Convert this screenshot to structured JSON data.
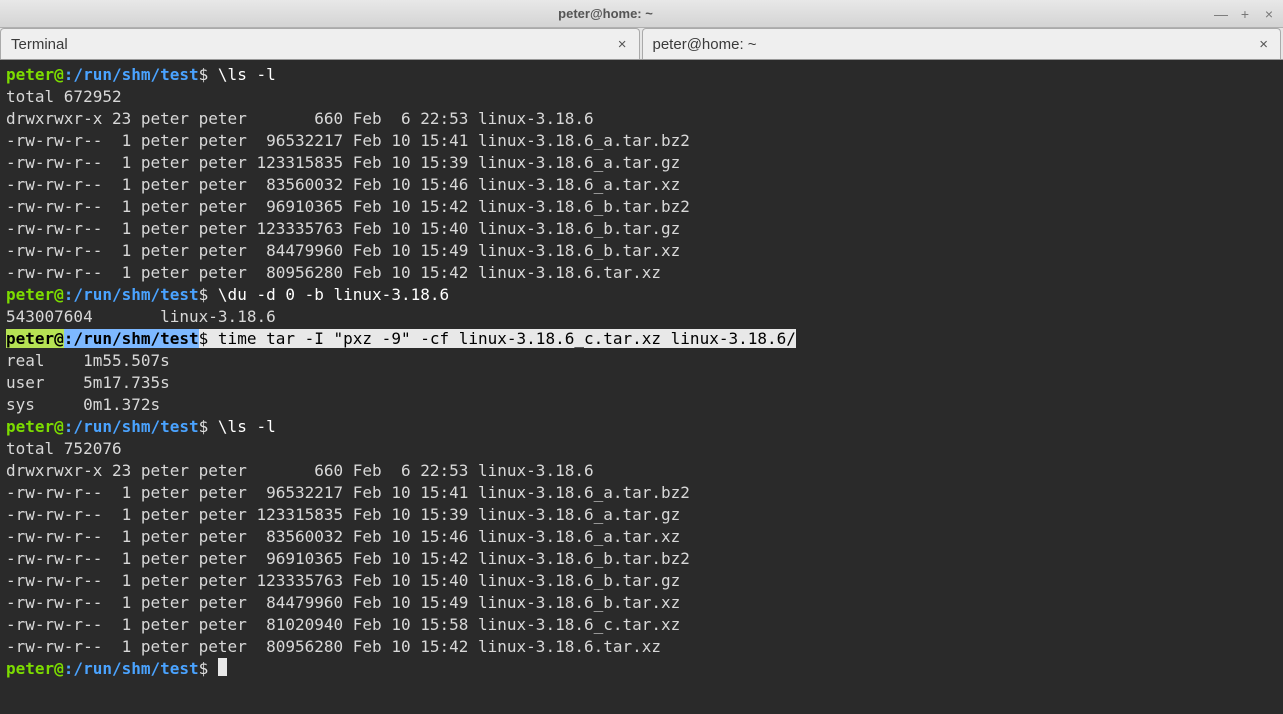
{
  "window": {
    "title": "peter@home: ~"
  },
  "tabs": [
    {
      "label": "Terminal"
    },
    {
      "label": "peter@home: ~"
    }
  ],
  "prompt": {
    "user": "peter@",
    "path": ":/run/shm/test",
    "dollar": "$ "
  },
  "cmd1": "\\ls -l",
  "total1": "total 672952",
  "ls1": [
    "drwxrwxr-x 23 peter peter       660 Feb  6 22:53 linux-3.18.6",
    "-rw-rw-r--  1 peter peter  96532217 Feb 10 15:41 linux-3.18.6_a.tar.bz2",
    "-rw-rw-r--  1 peter peter 123315835 Feb 10 15:39 linux-3.18.6_a.tar.gz",
    "-rw-rw-r--  1 peter peter  83560032 Feb 10 15:46 linux-3.18.6_a.tar.xz",
    "-rw-rw-r--  1 peter peter  96910365 Feb 10 15:42 linux-3.18.6_b.tar.bz2",
    "-rw-rw-r--  1 peter peter 123335763 Feb 10 15:40 linux-3.18.6_b.tar.gz",
    "-rw-rw-r--  1 peter peter  84479960 Feb 10 15:49 linux-3.18.6_b.tar.xz",
    "-rw-rw-r--  1 peter peter  80956280 Feb 10 15:42 linux-3.18.6.tar.xz"
  ],
  "cmd2": "\\du -d 0 -b linux-3.18.6",
  "du_out": "543007604       linux-3.18.6",
  "cmd3": "time tar -I \"pxz -9\" -cf linux-3.18.6_c.tar.xz linux-3.18.6/",
  "time_out": [
    "",
    "real    1m55.507s",
    "user    5m17.735s",
    "sys     0m1.372s"
  ],
  "cmd4": "\\ls -l",
  "total2": "total 752076",
  "ls2": [
    "drwxrwxr-x 23 peter peter       660 Feb  6 22:53 linux-3.18.6",
    "-rw-rw-r--  1 peter peter  96532217 Feb 10 15:41 linux-3.18.6_a.tar.bz2",
    "-rw-rw-r--  1 peter peter 123315835 Feb 10 15:39 linux-3.18.6_a.tar.gz",
    "-rw-rw-r--  1 peter peter  83560032 Feb 10 15:46 linux-3.18.6_a.tar.xz",
    "-rw-rw-r--  1 peter peter  96910365 Feb 10 15:42 linux-3.18.6_b.tar.bz2",
    "-rw-rw-r--  1 peter peter 123335763 Feb 10 15:40 linux-3.18.6_b.tar.gz",
    "-rw-rw-r--  1 peter peter  84479960 Feb 10 15:49 linux-3.18.6_b.tar.xz",
    "-rw-rw-r--  1 peter peter  81020940 Feb 10 15:58 linux-3.18.6_c.tar.xz",
    "-rw-rw-r--  1 peter peter  80956280 Feb 10 15:42 linux-3.18.6.tar.xz"
  ]
}
